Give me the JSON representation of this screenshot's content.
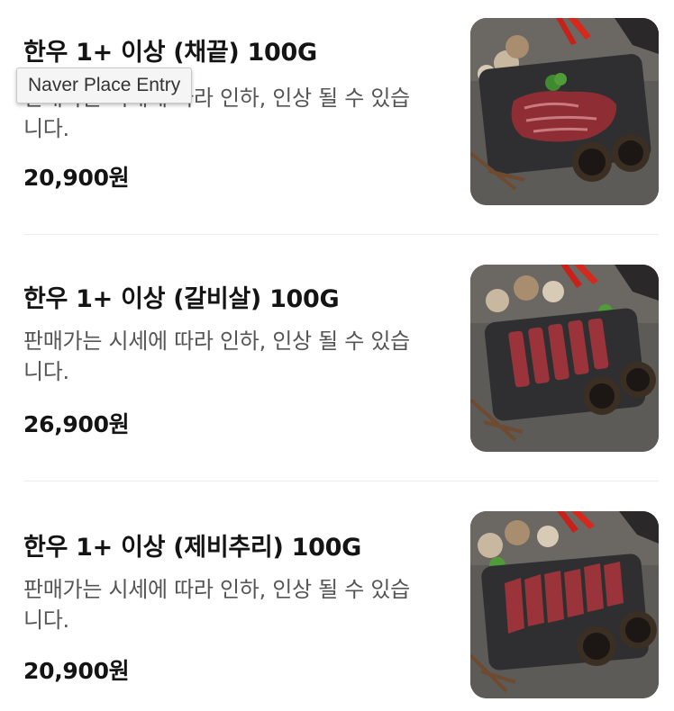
{
  "tooltip": {
    "text": "Naver Place Entry"
  },
  "colors": {
    "title": "#141414",
    "description": "#555555",
    "divider": "#ededed",
    "tooltip_bg": "#f5f5f5"
  },
  "menu": {
    "items": [
      {
        "title": "한우 1+ 이상 (채끝) 100G",
        "description": "판매가는 시세에 따라 인하, 인상 될 수 있습니다.",
        "price": "20,900원",
        "image": "steak-photo"
      },
      {
        "title": "한우 1+ 이상 (갈비살) 100G",
        "description": "판매가는 시세에 따라 인하, 인상 될 수 있습니다.",
        "price": "26,900원",
        "image": "rib-meat-photo"
      },
      {
        "title": "한우 1+ 이상 (제비추리) 100G",
        "description": "판매가는 시세에 따라 인하, 인상 될 수 있습니다.",
        "price": "20,900원",
        "image": "sliced-beef-photo"
      }
    ]
  }
}
